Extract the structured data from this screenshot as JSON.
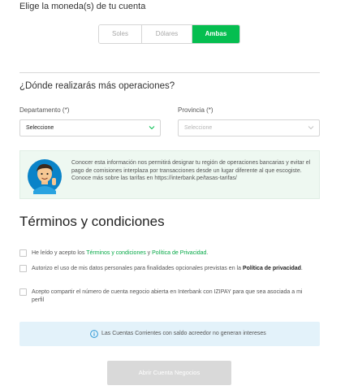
{
  "currency": {
    "heading": "Elige la moneda(s) de tu cuenta",
    "options": [
      "Soles",
      "Dólares",
      "Ambas"
    ],
    "selected": "Ambas"
  },
  "operations": {
    "heading": "¿Dónde realizarás más operaciones?",
    "department": {
      "label": "Departamento (*)",
      "value": "Seleccione"
    },
    "province": {
      "label": "Provincia (*)",
      "value": "Seleccione"
    }
  },
  "info": {
    "text": "Conocer esta información nos permitirá designar tu región de operaciones bancarias y evitar el pago de comisiones interplaza por transacciones desde un lugar diferente al que escogiste. Conoce más sobre las tarifas en https://interbank.pe/tasas-tarifas/"
  },
  "terms": {
    "title": "Términos y condiciones",
    "item1": {
      "pre": "He leído y acepto los ",
      "link1": "Términos y condiciones",
      "mid": " y ",
      "link2": "Política de Privacidad",
      "post": "."
    },
    "item2": {
      "pre": "Autorizo el uso de mis datos personales para finalidades opcionales previstas en la ",
      "bold": "Política de privacidad",
      "post": "."
    },
    "item3": {
      "text": "Acepto compartir el número de cuenta negocio abierta en Interbank con IZIPAY para que sea asociada a mi perfil"
    }
  },
  "notice": {
    "text": "Las Cuentas Corrientes con saldo acreedor no generan intereses"
  },
  "submit": {
    "label": "Abrir Cuenta Negocios"
  },
  "colors": {
    "accent": "#05be50",
    "info_bg": "#eef8f1",
    "notice_bg": "#e3f2fa",
    "disabled_button": "#d9d9d9"
  }
}
